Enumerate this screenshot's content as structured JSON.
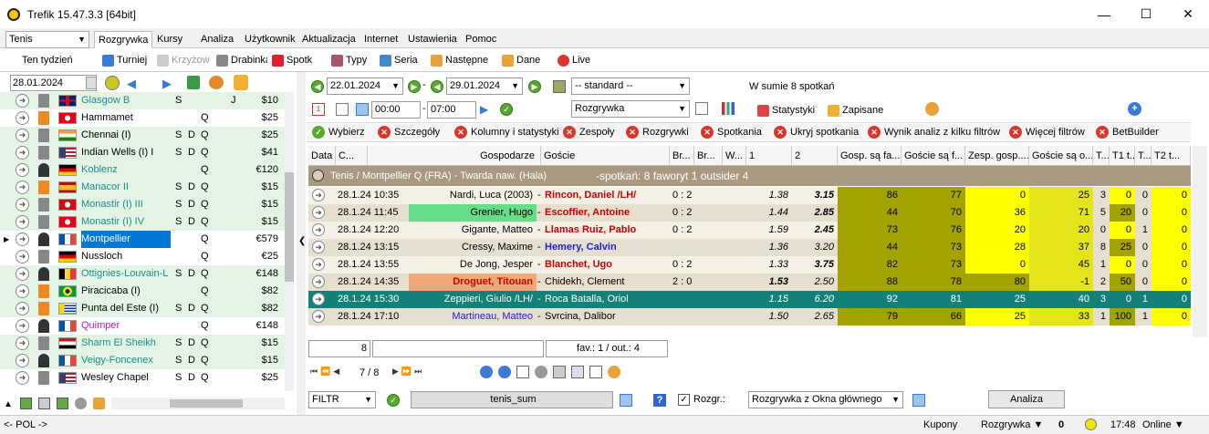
{
  "window": {
    "title": "Trefik 15.47.3.3 [64bit]"
  },
  "menu": {
    "sport": "Tenis",
    "tabs": [
      "Rozgrywka",
      "Kursy",
      "Analiza",
      "Użytkownik",
      "Aktualizacja",
      "Internet",
      "Ustawienia",
      "Pomoc"
    ]
  },
  "toolbar": {
    "week_label": "Ten tydzień",
    "buttons": [
      "Turniej",
      "Krzyżow",
      "Drabinka",
      "Spotk",
      "Typy",
      "Seria",
      "Następne",
      "Dane",
      "Live"
    ]
  },
  "left": {
    "date": "28.01.2024",
    "tournaments": [
      {
        "name": "Glasgow B",
        "s": "S",
        "d": "",
        "q": "",
        "j": "J",
        "prize": "$10",
        "name_color": "#1a8c8c",
        "bg": "#e4f4e4",
        "flag": "gb",
        "surface": "#888888"
      },
      {
        "name": "Hammamet",
        "s": "",
        "d": "",
        "q": "Q",
        "j": "",
        "prize": "$25",
        "name_color": "#000000",
        "bg": "#ffffff",
        "flag": "tn",
        "surface": "#ee8822"
      },
      {
        "name": "Chennai (I)",
        "s": "S",
        "d": "D",
        "q": "Q",
        "j": "",
        "prize": "$25",
        "name_color": "#000000",
        "bg": "#e4f4e4",
        "flag": "in",
        "surface": "#888888"
      },
      {
        "name": "Indian Wells (I) I",
        "s": "S",
        "d": "D",
        "q": "Q",
        "j": "",
        "prize": "$41",
        "name_color": "#000000",
        "bg": "#e4f4e4",
        "flag": "us",
        "surface": "#888888"
      },
      {
        "name": "Koblenz",
        "s": "",
        "d": "",
        "q": "Q",
        "j": "",
        "prize": "€120",
        "name_color": "#1a8c8c",
        "bg": "#e4f4e4",
        "flag": "de",
        "surface": "#333333"
      },
      {
        "name": "Manacor II",
        "s": "S",
        "d": "D",
        "q": "Q",
        "j": "",
        "prize": "$15",
        "name_color": "#1a8c8c",
        "bg": "#e4f4e4",
        "flag": "es",
        "surface": "#ee8822"
      },
      {
        "name": "Monastir (I) III",
        "s": "S",
        "d": "D",
        "q": "Q",
        "j": "",
        "prize": "$15",
        "name_color": "#1a8c8c",
        "bg": "#e4f4e4",
        "flag": "tn",
        "surface": "#888888"
      },
      {
        "name": "Monastir (I) IV",
        "s": "S",
        "d": "D",
        "q": "Q",
        "j": "",
        "prize": "$15",
        "name_color": "#1a8c8c",
        "bg": "#e4f4e4",
        "flag": "tn",
        "surface": "#888888"
      },
      {
        "name": "Montpellier",
        "s": "",
        "d": "",
        "q": "Q",
        "j": "",
        "prize": "€579",
        "name_color": "#ffffff",
        "bg": "#ffffff",
        "flag": "fr",
        "surface": "#333333",
        "selected": true
      },
      {
        "name": "Nussloch",
        "s": "",
        "d": "",
        "q": "Q",
        "j": "",
        "prize": "€25",
        "name_color": "#000000",
        "bg": "#ffffff",
        "flag": "de",
        "surface": "#888888"
      },
      {
        "name": "Ottignies-Louvain-L",
        "s": "S",
        "d": "D",
        "q": "Q",
        "j": "",
        "prize": "€148",
        "name_color": "#1a8c8c",
        "bg": "#e4f4e4",
        "flag": "be",
        "surface": "#333333"
      },
      {
        "name": "Piracicaba (I)",
        "s": "",
        "d": "",
        "q": "Q",
        "j": "",
        "prize": "$82",
        "name_color": "#000000",
        "bg": "#e4f4e4",
        "flag": "br",
        "surface": "#ee8822"
      },
      {
        "name": "Punta del Este (I)",
        "s": "S",
        "d": "D",
        "q": "Q",
        "j": "",
        "prize": "$82",
        "name_color": "#000000",
        "bg": "#e4f4e4",
        "flag": "uy",
        "surface": "#ee8822"
      },
      {
        "name": "Quimper",
        "s": "",
        "d": "",
        "q": "Q",
        "j": "",
        "prize": "€148",
        "name_color": "#b020b0",
        "bg": "#ffffff",
        "flag": "fr",
        "surface": "#333333"
      },
      {
        "name": "Sharm El Sheikh",
        "s": "S",
        "d": "D",
        "q": "Q",
        "j": "",
        "prize": "$15",
        "name_color": "#1a8c8c",
        "bg": "#e4f4e4",
        "flag": "eg",
        "surface": "#888888"
      },
      {
        "name": "Veigy-Foncenex",
        "s": "S",
        "d": "D",
        "q": "Q",
        "j": "",
        "prize": "$15",
        "name_color": "#1a8c8c",
        "bg": "#e4f4e4",
        "flag": "fr",
        "surface": "#333333"
      },
      {
        "name": "Wesley Chapel",
        "s": "S",
        "d": "D",
        "q": "Q",
        "j": "",
        "prize": "$25",
        "name_color": "#000000",
        "bg": "#ffffff",
        "flag": "us",
        "surface": "#888888"
      }
    ],
    "lang": "<- POL ->"
  },
  "right": {
    "date_from": "22.01.2024",
    "date_to": "29.01.2024",
    "dash": "-",
    "standard": "-- standard --",
    "total": "W sumie 8 spotkań",
    "time_from": "00:00",
    "time_to": "07:00",
    "mode": "Rozgrywka",
    "stats_label": "Statystyki",
    "saved_label": "Zapisane",
    "filters": [
      "Wybierz",
      "Szczegóły",
      "Kolumny i statystyki",
      "Zespoły",
      "Rozgrywki",
      "Spotkania",
      "Ukryj spotkania",
      "Wynik analiz z kilku filtrów",
      "Więcej filtrów",
      "BetBuilder"
    ],
    "columns": [
      "Data",
      "C...",
      "Gospodarze",
      "Goście",
      "Br...",
      "Br...",
      "W...",
      "1",
      "2",
      "Gosp. są fa...",
      "Goście są f...",
      "Zesp. gosp....",
      "Goście są o...",
      "T...",
      "T1 t...",
      "T...",
      "T2 t..."
    ],
    "group": {
      "title": "Tenis / Montpellier Q (FRA)  -  Twarda naw. (Hala)",
      "summary": "-spotkań: 8      faworyt 1   outsider 4"
    },
    "matches": [
      {
        "date": "28.1.24 10:35",
        "home": "Nardi, Luca (2003)",
        "sep": "-",
        "away": "Rincon, Daniel /LH/",
        "br": "0 : 2",
        "o1": "1.38",
        "o2": "3.15",
        "c1": "86",
        "c2": "77",
        "c3": "0",
        "c4": "25",
        "t1": "3",
        "t2": "0",
        "t3": "0",
        "t4": "0",
        "home_color": "#000000",
        "away_color": "#cc0000",
        "home_bg": "",
        "away_bg": "",
        "bold2": true
      },
      {
        "date": "28.1.24 11:45",
        "home": "Grenier, Hugo",
        "sep": "-",
        "away": "Escoffier, Antoine",
        "br": "0 : 2",
        "o1": "1.44",
        "o2": "2.85",
        "c1": "44",
        "c2": "70",
        "c3": "36",
        "c4": "71",
        "t1": "5",
        "t2": "20",
        "t3": "0",
        "t4": "0",
        "home_color": "#000000",
        "away_color": "#cc0000",
        "home_bg": "#66dd88",
        "away_bg": "",
        "bold2": true
      },
      {
        "date": "28.1.24 12:20",
        "home": "Gigante, Matteo",
        "sep": "-",
        "away": "Llamas Ruiz, Pablo",
        "br": "0 : 2",
        "o1": "1.59",
        "o2": "2.45",
        "c1": "73",
        "c2": "76",
        "c3": "20",
        "c4": "20",
        "t1": "0",
        "t2": "0",
        "t3": "1",
        "t4": "0",
        "home_color": "#000000",
        "away_color": "#cc0000",
        "home_bg": "",
        "away_bg": "",
        "bold2": true
      },
      {
        "date": "28.1.24 13:15",
        "home": "Cressy, Maxime",
        "sep": "-",
        "away": "Hemery, Calvin",
        "br": "",
        "o1": "1.36",
        "o2": "3.20",
        "c1": "44",
        "c2": "73",
        "c3": "28",
        "c4": "37",
        "t1": "8",
        "t2": "25",
        "t3": "0",
        "t4": "0",
        "home_color": "#000000",
        "away_color": "#2222cc",
        "home_bg": "",
        "away_bg": "",
        "bold2": false
      },
      {
        "date": "28.1.24 13:55",
        "home": "De Jong, Jesper",
        "sep": "-",
        "away": "Blanchet, Ugo",
        "br": "0 : 2",
        "o1": "1.33",
        "o2": "3.75",
        "c1": "82",
        "c2": "73",
        "c3": "0",
        "c4": "45",
        "t1": "1",
        "t2": "0",
        "t3": "0",
        "t4": "0",
        "home_color": "#000000",
        "away_color": "#cc0000",
        "home_bg": "",
        "away_bg": "",
        "bold2": true
      },
      {
        "date": "28.1.24 14:35",
        "home": "Droguet, Titouan",
        "sep": "-",
        "away": "Chidekh, Clement",
        "br": "2 : 0",
        "o1": "1.53",
        "o2": "2.50",
        "c1": "88",
        "c2": "78",
        "c3": "80",
        "c4": "-1",
        "t1": "2",
        "t2": "50",
        "t3": "0",
        "t4": "0",
        "home_color": "#cc0000",
        "away_color": "#000000",
        "home_bg": "#f0a878",
        "away_bg": "",
        "bold1": true
      },
      {
        "date": "28.1.24 15:30",
        "home": "Zeppieri, Giulio /LH/",
        "sep": "-",
        "away": "Roca Batalla, Oriol",
        "br": "",
        "o1": "1.15",
        "o2": "6.20",
        "c1": "92",
        "c2": "81",
        "c3": "25",
        "c4": "40",
        "t1": "3",
        "t2": "0",
        "t3": "1",
        "t4": "0",
        "home_color": "#ffffff",
        "away_color": "#ffffff",
        "home_bg": "",
        "away_bg": "",
        "selected": true
      },
      {
        "date": "28.1.24 17:10",
        "home": "Martineau, Matteo",
        "sep": "-",
        "away": "Svrcina, Dalibor",
        "br": "",
        "o1": "1.50",
        "o2": "2.65",
        "c1": "79",
        "c2": "66",
        "c3": "25",
        "c4": "33",
        "t1": "1",
        "t2": "100",
        "t3": "1",
        "t4": "0",
        "home_color": "#2222cc",
        "away_color": "#000000",
        "home_bg": "",
        "away_bg": ""
      }
    ],
    "footer_count": "8",
    "fav_out": "fav.: 1 / out.: 4",
    "nav_pos": "7 / 8",
    "filter_label": "FILTR",
    "filter_name": "tenis_sum",
    "rozgr_label": "Rozgr.:",
    "rozgr_source": "Rozgrywka z Okna głównego",
    "analyze_btn": "Analiza"
  },
  "status": {
    "kupony": "Kupony",
    "rozgrywka": "Rozgrywka ▼",
    "count": "0",
    "time": "17:48",
    "online": "Online ▼"
  }
}
